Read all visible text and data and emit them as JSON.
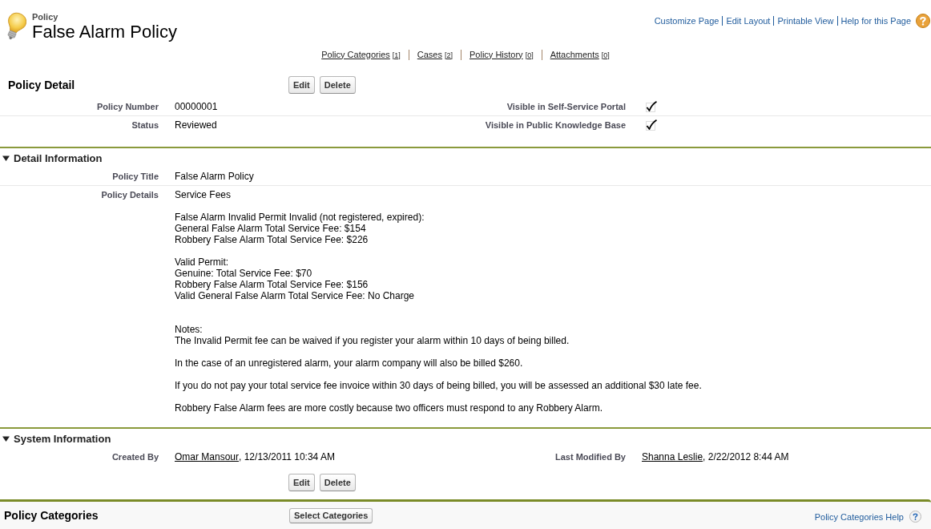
{
  "header": {
    "object_type": "Policy",
    "title": "False Alarm Policy",
    "links": [
      "Customize Page",
      "Edit Layout",
      "Printable View",
      "Help for this Page"
    ]
  },
  "related_links": [
    {
      "label": "Policy Categories",
      "count": "[1]"
    },
    {
      "label": "Cases",
      "count": "[2]"
    },
    {
      "label": "Policy History",
      "count": "[0]"
    },
    {
      "label": "Attachments",
      "count": "[0]"
    }
  ],
  "detail": {
    "title": "Policy Detail",
    "buttons": [
      "Edit",
      "Delete"
    ],
    "rows": [
      {
        "left": {
          "kind": "text",
          "label": "Policy Number",
          "value": "00000001"
        },
        "right": {
          "kind": "checkbox",
          "label": "Visible in Self-Service Portal",
          "checked": true
        }
      },
      {
        "left": {
          "kind": "text",
          "label": "Status",
          "value": "Reviewed"
        },
        "right": {
          "kind": "checkbox",
          "label": "Visible in Public Knowledge Base",
          "checked": true
        }
      }
    ]
  },
  "sections": [
    {
      "title": "Detail Information",
      "expanded": true,
      "rows": [
        {
          "left": {
            "kind": "text",
            "label": "Policy Title",
            "value": "False Alarm Policy"
          }
        },
        {
          "left": {
            "kind": "long_text",
            "label": "Policy Details",
            "groups": [
              [
                "Service Fees",
                "False Alarm Invalid Permit Invalid (not registered, expired):\nGeneral False Alarm Total Service Fee: $154\nRobbery False Alarm Total Service Fee: $226",
                "Valid Permit:\nGenuine: Total Service Fee: $70\nRobbery False Alarm Total Service Fee: $156\nValid General False Alarm Total Service Fee: No Charge"
              ],
              [
                "Notes:\nThe Invalid Permit fee can be waived if you register your alarm within 10 days of being billed.",
                "In the case of an unregistered alarm, your alarm company will also be billed $260.",
                "If you do not pay your total service fee invoice within 30 days of being billed, you will be assessed an additional $30 late fee.",
                "Robbery False Alarm fees are more costly because two officers must respond to any Robbery Alarm."
              ]
            ]
          }
        }
      ]
    },
    {
      "title": "System Information",
      "expanded": true,
      "rows": [
        {
          "left": {
            "kind": "user_stamp",
            "label": "Created By",
            "user": "Omar Mansour",
            "stamp": ", 12/13/2011 10:34 AM"
          },
          "right": {
            "kind": "user_stamp",
            "label": "Last Modified By",
            "user": "Shanna Leslie",
            "stamp": ", 2/22/2012 8:44 AM"
          }
        }
      ]
    }
  ],
  "buttons": [
    "Edit",
    "Delete"
  ],
  "related_list": {
    "title": "Policy Categories",
    "button": "Select Categories",
    "help": "Policy Categories Help"
  }
}
